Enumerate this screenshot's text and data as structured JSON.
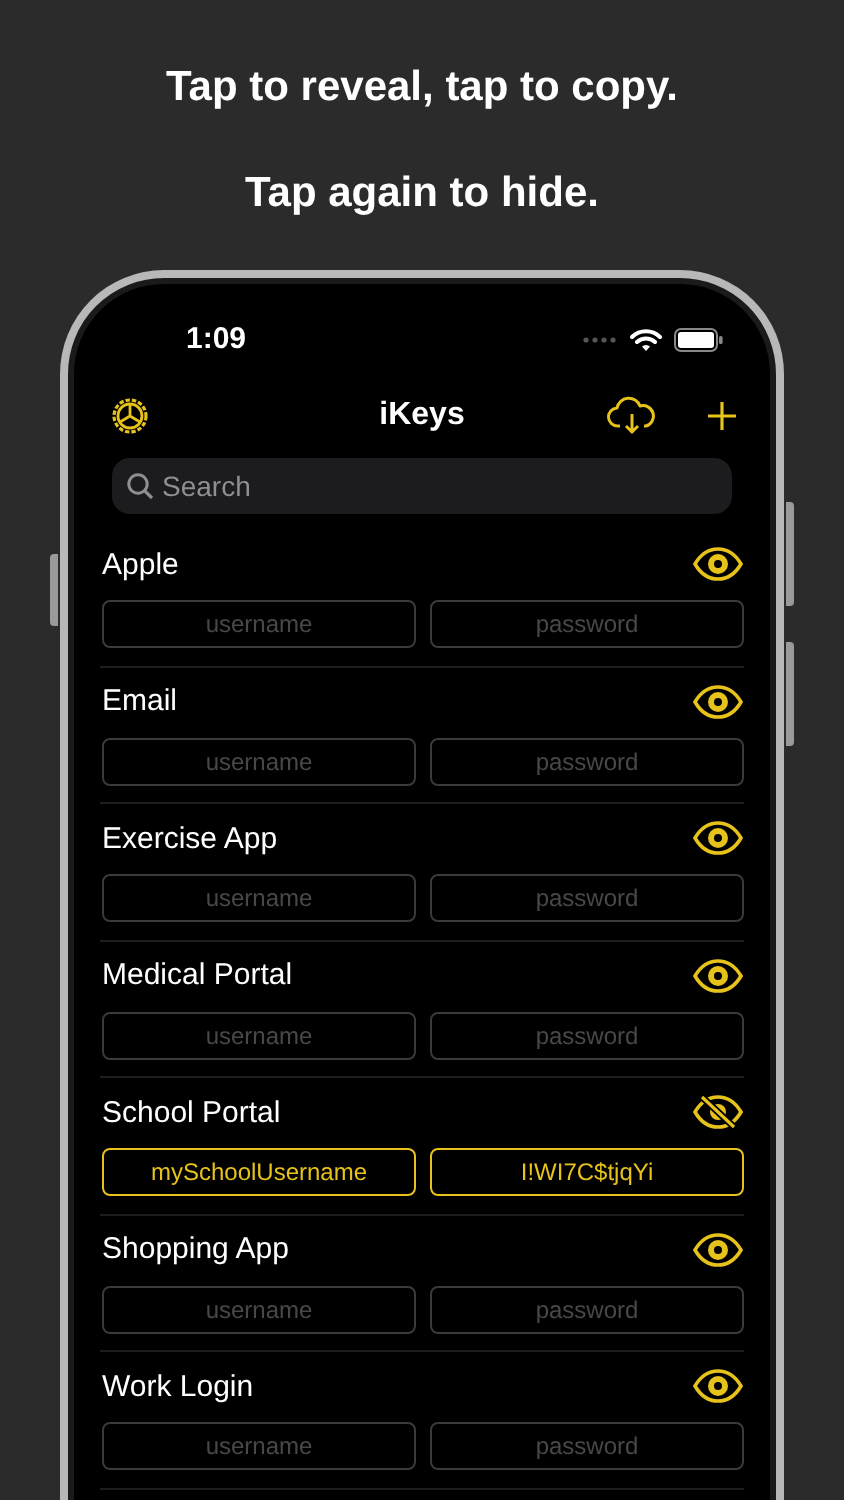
{
  "headline": [
    "Tap to reveal, tap to copy.",
    "Tap again to hide."
  ],
  "status_bar": {
    "time": "1:09"
  },
  "nav": {
    "title": "iKeys"
  },
  "search": {
    "placeholder": "Search"
  },
  "entries": [
    {
      "name": "Apple",
      "revealed": false,
      "username_placeholder": "username",
      "password_placeholder": "password"
    },
    {
      "name": "Email",
      "revealed": false,
      "username_placeholder": "username",
      "password_placeholder": "password"
    },
    {
      "name": "Exercise App",
      "revealed": false,
      "username_placeholder": "username",
      "password_placeholder": "password"
    },
    {
      "name": "Medical Portal",
      "revealed": false,
      "username_placeholder": "username",
      "password_placeholder": "password"
    },
    {
      "name": "School Portal",
      "revealed": true,
      "username": "mySchoolUsername",
      "password": "I!WI7C$tjqYi"
    },
    {
      "name": "Shopping App",
      "revealed": false,
      "username_placeholder": "username",
      "password_placeholder": "password"
    },
    {
      "name": "Work Login",
      "revealed": false,
      "username_placeholder": "username",
      "password_placeholder": "password"
    }
  ]
}
